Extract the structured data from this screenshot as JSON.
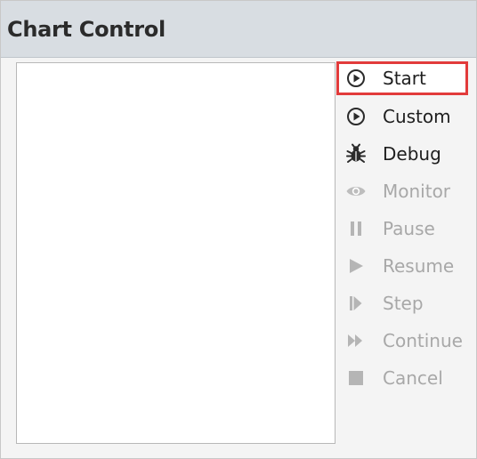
{
  "window": {
    "title": "Chart Control"
  },
  "buttons": {
    "start": {
      "label": "Start",
      "icon": "play-circle-icon",
      "enabled": true
    },
    "custom": {
      "label": "Custom",
      "icon": "play-circle-icon",
      "enabled": true
    },
    "debug": {
      "label": "Debug",
      "icon": "bug-icon",
      "enabled": true
    },
    "monitor": {
      "label": "Monitor",
      "icon": "eye-icon",
      "enabled": false
    },
    "pause": {
      "label": "Pause",
      "icon": "pause-icon",
      "enabled": false
    },
    "resume": {
      "label": "Resume",
      "icon": "play-icon",
      "enabled": false
    },
    "step": {
      "label": "Step",
      "icon": "step-icon",
      "enabled": false
    },
    "continue": {
      "label": "Continue",
      "icon": "fast-forward-icon",
      "enabled": false
    },
    "cancel": {
      "label": "Cancel",
      "icon": "stop-square-icon",
      "enabled": false
    }
  },
  "colors": {
    "highlight_border": "#e23b3b",
    "enabled_text": "#1e1e1e",
    "disabled_text": "#a8a8a8",
    "title_bar": "#d8dde2"
  }
}
